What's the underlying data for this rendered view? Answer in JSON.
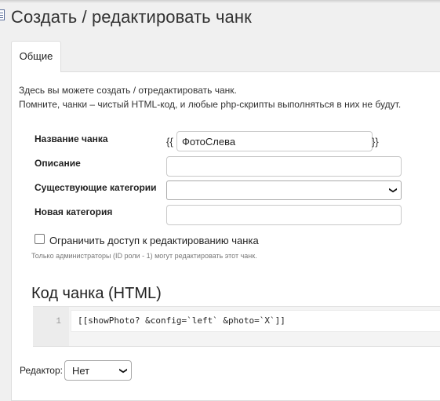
{
  "page": {
    "title": "Создать / редактировать чанк"
  },
  "tabs": [
    {
      "label": "Общие",
      "active": true
    }
  ],
  "intro": {
    "line1": "Здесь вы можете создать / отредактировать чанк.",
    "line2": "Помните, чанки – чистый HTML-код, и любые php-скрипты выполняться в них не будут."
  },
  "form": {
    "name": {
      "label": "Название чанка",
      "value": "ФотоСлева",
      "brace_open": "{{",
      "brace_close": "}}"
    },
    "description": {
      "label": "Описание",
      "value": ""
    },
    "existing_category": {
      "label": "Существующие категории",
      "selected": ""
    },
    "new_category": {
      "label": "Новая категория",
      "value": ""
    },
    "restrict_access": {
      "label": "Ограничить доступ к редактированию чанка",
      "checked": false,
      "hint": "Только администраторы (ID роли - 1) могут редактировать этот чанк."
    }
  },
  "code": {
    "title": "Код чанка (HTML)",
    "lines": [
      {
        "number": "1",
        "text": "[[showPhoto? &config=`left` &photo=`X`]]"
      }
    ]
  },
  "editor": {
    "label": "Редактор:",
    "selected": "Нет"
  },
  "icons": {
    "title": "document-icon",
    "select": "chevron-down-icon"
  }
}
